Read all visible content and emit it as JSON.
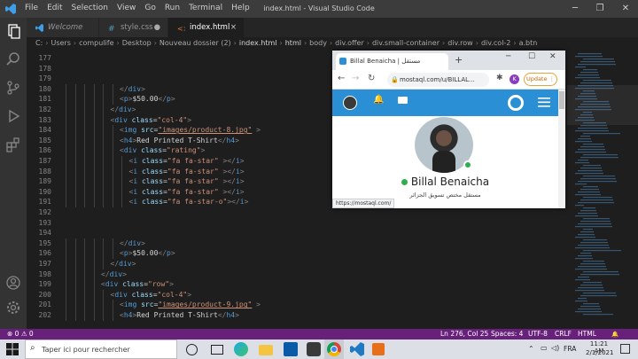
{
  "titlebar": {
    "menu": [
      "File",
      "Edit",
      "Selection",
      "View",
      "Go",
      "Run",
      "Terminal",
      "Help"
    ],
    "title": "index.html - Visual Studio Code",
    "minimize": "─",
    "maximize": "❐",
    "close": "✕"
  },
  "tabs": [
    {
      "label": "Welcome",
      "icon": "vscode-icon"
    },
    {
      "label": "style.css",
      "icon": "css-icon",
      "dot": "●"
    },
    {
      "label": "index.html",
      "icon": "html-icon",
      "close": "×"
    }
  ],
  "breadcrumb": [
    "C:",
    "Users",
    "compulife",
    "Desktop",
    "Nouveau dossier (2)",
    "index.html",
    "html",
    "body",
    "div.offer",
    "div.small-container",
    "div.row",
    "div.col-2",
    "a.btn"
  ],
  "editor": {
    "lines": [
      {
        "n": "177",
        "i": 0,
        "t": []
      },
      {
        "n": "178",
        "i": 0,
        "t": []
      },
      {
        "n": "179",
        "i": 0,
        "t": []
      },
      {
        "n": "180",
        "i": 6,
        "t": [
          [
            "pu",
            "</"
          ],
          [
            "tg",
            "div"
          ],
          [
            "pu",
            ">"
          ]
        ]
      },
      {
        "n": "181",
        "i": 6,
        "t": [
          [
            "pu",
            "<"
          ],
          [
            "tg",
            "p"
          ],
          [
            "pu",
            ">"
          ],
          [
            "",
            "$50.00"
          ],
          [
            "pu",
            "</"
          ],
          [
            "tg",
            "p"
          ],
          [
            "pu",
            ">"
          ]
        ]
      },
      {
        "n": "182",
        "i": 5,
        "t": [
          [
            "pu",
            "</"
          ],
          [
            "tg",
            "div"
          ],
          [
            "pu",
            ">"
          ]
        ]
      },
      {
        "n": "183",
        "i": 5,
        "t": [
          [
            "pu",
            "<"
          ],
          [
            "tg",
            "div"
          ],
          [
            "",
            ""
          ],
          [
            "at",
            " class"
          ],
          [
            "",
            "="
          ],
          [
            "st",
            "\"col-4\""
          ],
          [
            "pu",
            ">"
          ]
        ]
      },
      {
        "n": "184",
        "i": 6,
        "t": [
          [
            "pu",
            "<"
          ],
          [
            "tg",
            "img"
          ],
          [
            "at",
            " src"
          ],
          [
            "",
            "="
          ],
          [
            "st",
            "\"images/product-8.jpg\""
          ],
          [
            "pu",
            " >"
          ]
        ]
      },
      {
        "n": "185",
        "i": 6,
        "t": [
          [
            "pu",
            "<"
          ],
          [
            "tg",
            "h4"
          ],
          [
            "pu",
            ">"
          ],
          [
            "",
            "Red Printed T-Shirt"
          ],
          [
            "pu",
            "</"
          ],
          [
            "tg",
            "h4"
          ],
          [
            "pu",
            ">"
          ]
        ]
      },
      {
        "n": "186",
        "i": 6,
        "t": [
          [
            "pu",
            "<"
          ],
          [
            "tg",
            "div"
          ],
          [
            "at",
            " class"
          ],
          [
            "",
            "="
          ],
          [
            "st",
            "\"rating\""
          ],
          [
            "pu",
            ">"
          ]
        ]
      },
      {
        "n": "187",
        "i": 7,
        "t": [
          [
            "pu",
            "<"
          ],
          [
            "tg",
            "i"
          ],
          [
            "at",
            " class"
          ],
          [
            "",
            "="
          ],
          [
            "st",
            "\"fa fa-star\""
          ],
          [
            "pu",
            " ></"
          ],
          [
            "tg",
            "i"
          ],
          [
            "pu",
            ">"
          ]
        ]
      },
      {
        "n": "188",
        "i": 7,
        "t": [
          [
            "pu",
            "<"
          ],
          [
            "tg",
            "i"
          ],
          [
            "at",
            " class"
          ],
          [
            "",
            "="
          ],
          [
            "st",
            "\"fa fa-star\""
          ],
          [
            "pu",
            " ></"
          ],
          [
            "tg",
            "i"
          ],
          [
            "pu",
            ">"
          ]
        ]
      },
      {
        "n": "189",
        "i": 7,
        "t": [
          [
            "pu",
            "<"
          ],
          [
            "tg",
            "i"
          ],
          [
            "at",
            " class"
          ],
          [
            "",
            "="
          ],
          [
            "st",
            "\"fa fa-star\""
          ],
          [
            "pu",
            " ></"
          ],
          [
            "tg",
            "i"
          ],
          [
            "pu",
            ">"
          ]
        ]
      },
      {
        "n": "190",
        "i": 7,
        "t": [
          [
            "pu",
            "<"
          ],
          [
            "tg",
            "i"
          ],
          [
            "at",
            " class"
          ],
          [
            "",
            "="
          ],
          [
            "st",
            "\"fa fa-star\""
          ],
          [
            "pu",
            " ></"
          ],
          [
            "tg",
            "i"
          ],
          [
            "pu",
            ">"
          ]
        ]
      },
      {
        "n": "191",
        "i": 7,
        "t": [
          [
            "pu",
            "<"
          ],
          [
            "tg",
            "i"
          ],
          [
            "at",
            " class"
          ],
          [
            "",
            "="
          ],
          [
            "st",
            "\"fa fa-star-o\""
          ],
          [
            "pu",
            "></"
          ],
          [
            "tg",
            "i"
          ],
          [
            "pu",
            ">"
          ]
        ]
      },
      {
        "n": "192",
        "i": 0,
        "t": []
      },
      {
        "n": "193",
        "i": 0,
        "t": []
      },
      {
        "n": "194",
        "i": 0,
        "t": []
      },
      {
        "n": "195",
        "i": 6,
        "t": [
          [
            "pu",
            "</"
          ],
          [
            "tg",
            "div"
          ],
          [
            "pu",
            ">"
          ]
        ]
      },
      {
        "n": "196",
        "i": 6,
        "t": [
          [
            "pu",
            "<"
          ],
          [
            "tg",
            "p"
          ],
          [
            "pu",
            ">"
          ],
          [
            "",
            "$50.00"
          ],
          [
            "pu",
            "</"
          ],
          [
            "tg",
            "p"
          ],
          [
            "pu",
            ">"
          ]
        ]
      },
      {
        "n": "197",
        "i": 5,
        "t": [
          [
            "pu",
            "</"
          ],
          [
            "tg",
            "div"
          ],
          [
            "pu",
            ">"
          ]
        ]
      },
      {
        "n": "198",
        "i": 4,
        "t": [
          [
            "pu",
            "</"
          ],
          [
            "tg",
            "div"
          ],
          [
            "pu",
            ">"
          ]
        ]
      },
      {
        "n": "199",
        "i": 4,
        "t": [
          [
            "pu",
            "<"
          ],
          [
            "tg",
            "div"
          ],
          [
            "at",
            " class"
          ],
          [
            "",
            "="
          ],
          [
            "st",
            "\"row\""
          ],
          [
            "pu",
            ">"
          ]
        ]
      },
      {
        "n": "200",
        "i": 5,
        "t": [
          [
            "pu",
            "<"
          ],
          [
            "tg",
            "div"
          ],
          [
            "at",
            " class"
          ],
          [
            "",
            "="
          ],
          [
            "st",
            "\"col-4\""
          ],
          [
            "pu",
            ">"
          ]
        ]
      },
      {
        "n": "201",
        "i": 6,
        "t": [
          [
            "pu",
            "<"
          ],
          [
            "tg",
            "img"
          ],
          [
            "at",
            " src"
          ],
          [
            "",
            "="
          ],
          [
            "st",
            "\"images/product-9.jpg\""
          ],
          [
            "pu",
            " >"
          ]
        ]
      },
      {
        "n": "202",
        "i": 6,
        "t": [
          [
            "pu",
            "<"
          ],
          [
            "tg",
            "h4"
          ],
          [
            "pu",
            ">"
          ],
          [
            "",
            "Red Printed T-Shirt"
          ],
          [
            "pu",
            "</"
          ],
          [
            "tg",
            "h4"
          ],
          [
            "pu",
            ">"
          ]
        ]
      }
    ]
  },
  "browser": {
    "tab_title": "Billal Benaicha | مستقل",
    "new_tab": "+",
    "url": "mostaql.com/u/BILLAL...",
    "update_label": "Update",
    "avatar_letter": "K",
    "profile_name": "Billal Benaicha",
    "meta": "مستقل  مختص تسويق  الجزائر",
    "status_url": "https://mostaql.com/"
  },
  "status": {
    "problems": "⊗ 0 ⚠ 0",
    "position": "Ln 276, Col 25",
    "spaces": "Spaces: 4",
    "encoding": "UTF-8",
    "eol": "CRLF",
    "language": "HTML",
    "bell": "🔔"
  },
  "taskbar": {
    "search_placeholder": "Taper ici pour rechercher",
    "lang": "FRA",
    "time": "11:21 AM",
    "date": "2/1/2021"
  },
  "colors": {
    "statusbar": "#68217a",
    "site_header": "#2b8fd6",
    "online": "#2eae4f"
  }
}
